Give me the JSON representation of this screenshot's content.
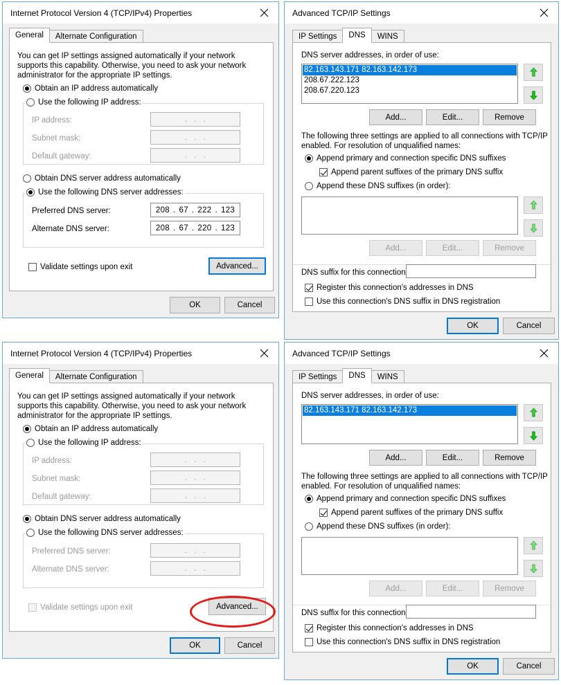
{
  "meta": {
    "accent_blue": "#0078d7",
    "selection_blue": "#0a7fdd",
    "annotation_red": "#e01b1b",
    "arrow_green": "#2fbf2f"
  },
  "common": {
    "close_icon": "close-icon",
    "ok_label": "OK",
    "cancel_label": "Cancel",
    "add_label": "Add...",
    "edit_label": "Edit...",
    "remove_label": "Remove",
    "advanced_label": "Advanced...",
    "move_up_icon": "arrow-up-icon",
    "move_down_icon": "arrow-down-icon",
    "ip_blank": [
      ".",
      ".",
      "."
    ]
  },
  "ipv4_properties": {
    "title": "Internet Protocol Version 4 (TCP/IPv4) Properties",
    "tabs": [
      {
        "label": "General",
        "active": true
      },
      {
        "label": "Alternate Configuration",
        "active": false
      }
    ],
    "description": "You can get IP settings assigned automatically if your network supports this capability. Otherwise, you need to ask your network administrator for the appropriate IP settings.",
    "radio_obtain_ip": "Obtain an IP address automatically",
    "radio_use_ip": "Use the following IP address:",
    "label_ip_address": "IP address:",
    "label_subnet_mask": "Subnet mask:",
    "label_default_gateway": "Default gateway:",
    "radio_obtain_dns": "Obtain DNS server address automatically",
    "radio_use_dns": "Use the following DNS server addresses:",
    "label_preferred_dns": "Preferred DNS server:",
    "label_alternate_dns": "Alternate DNS server:",
    "check_validate": "Validate settings upon exit"
  },
  "advanced_settings": {
    "title": "Advanced TCP/IP Settings",
    "tabs": [
      {
        "label": "IP Settings",
        "active": false
      },
      {
        "label": "DNS",
        "active": true
      },
      {
        "label": "WINS",
        "active": false
      }
    ],
    "dns_servers_label": "DNS server addresses, in order of use:",
    "explain_line1": "The following three settings are applied to all connections with TCP/IP",
    "explain_line2": "enabled. For resolution of unqualified names:",
    "radio_append_primary": "Append primary and connection specific DNS suffixes",
    "check_append_parent": "Append parent suffixes of the primary DNS suffix",
    "radio_append_these": "Append these DNS suffixes (in order):",
    "dns_suffix_label": "DNS suffix for this connection:",
    "dns_suffix_value": "",
    "check_register": "Register this connection's addresses in DNS",
    "check_use_suffix": "Use this connection's DNS suffix in DNS registration"
  },
  "panel_top_left": {
    "ip_mode": "obtain",
    "dns_mode": "use_following",
    "preferred_dns": {
      "o1": "208",
      "o2": "67",
      "o3": "222",
      "o4": "123"
    },
    "alternate_dns": {
      "o1": "208",
      "o2": "67",
      "o3": "220",
      "o4": "123"
    },
    "validate_checked": false,
    "advanced_focused": true,
    "ok_focused": false
  },
  "panel_bottom_left": {
    "ip_mode": "obtain",
    "dns_mode": "obtain",
    "preferred_dns": {
      "o1": "",
      "o2": "",
      "o3": "",
      "o4": ""
    },
    "alternate_dns": {
      "o1": "",
      "o2": "",
      "o3": "",
      "o4": ""
    },
    "validate_checked": false,
    "advanced_focused": false,
    "ok_focused": true,
    "annotation": "red-ellipse-highlight-advanced-button"
  },
  "panel_top_right": {
    "dns_server_list": [
      {
        "value": "82.163.143.171 82.163.142.173",
        "selected": true
      },
      {
        "value": "208.67.222.123",
        "selected": false
      },
      {
        "value": "208.67.220.123",
        "selected": false
      }
    ],
    "suffix_list": [],
    "append_mode": "primary",
    "append_parent_checked": true,
    "register_checked": true,
    "use_suffix_checked": false,
    "ok_focused": true
  },
  "panel_bottom_right": {
    "dns_server_list": [
      {
        "value": "82.163.143.171 82.163.142.173",
        "selected": true
      }
    ],
    "suffix_list": [],
    "append_mode": "primary",
    "append_parent_checked": true,
    "register_checked": true,
    "use_suffix_checked": false,
    "ok_focused": true
  }
}
